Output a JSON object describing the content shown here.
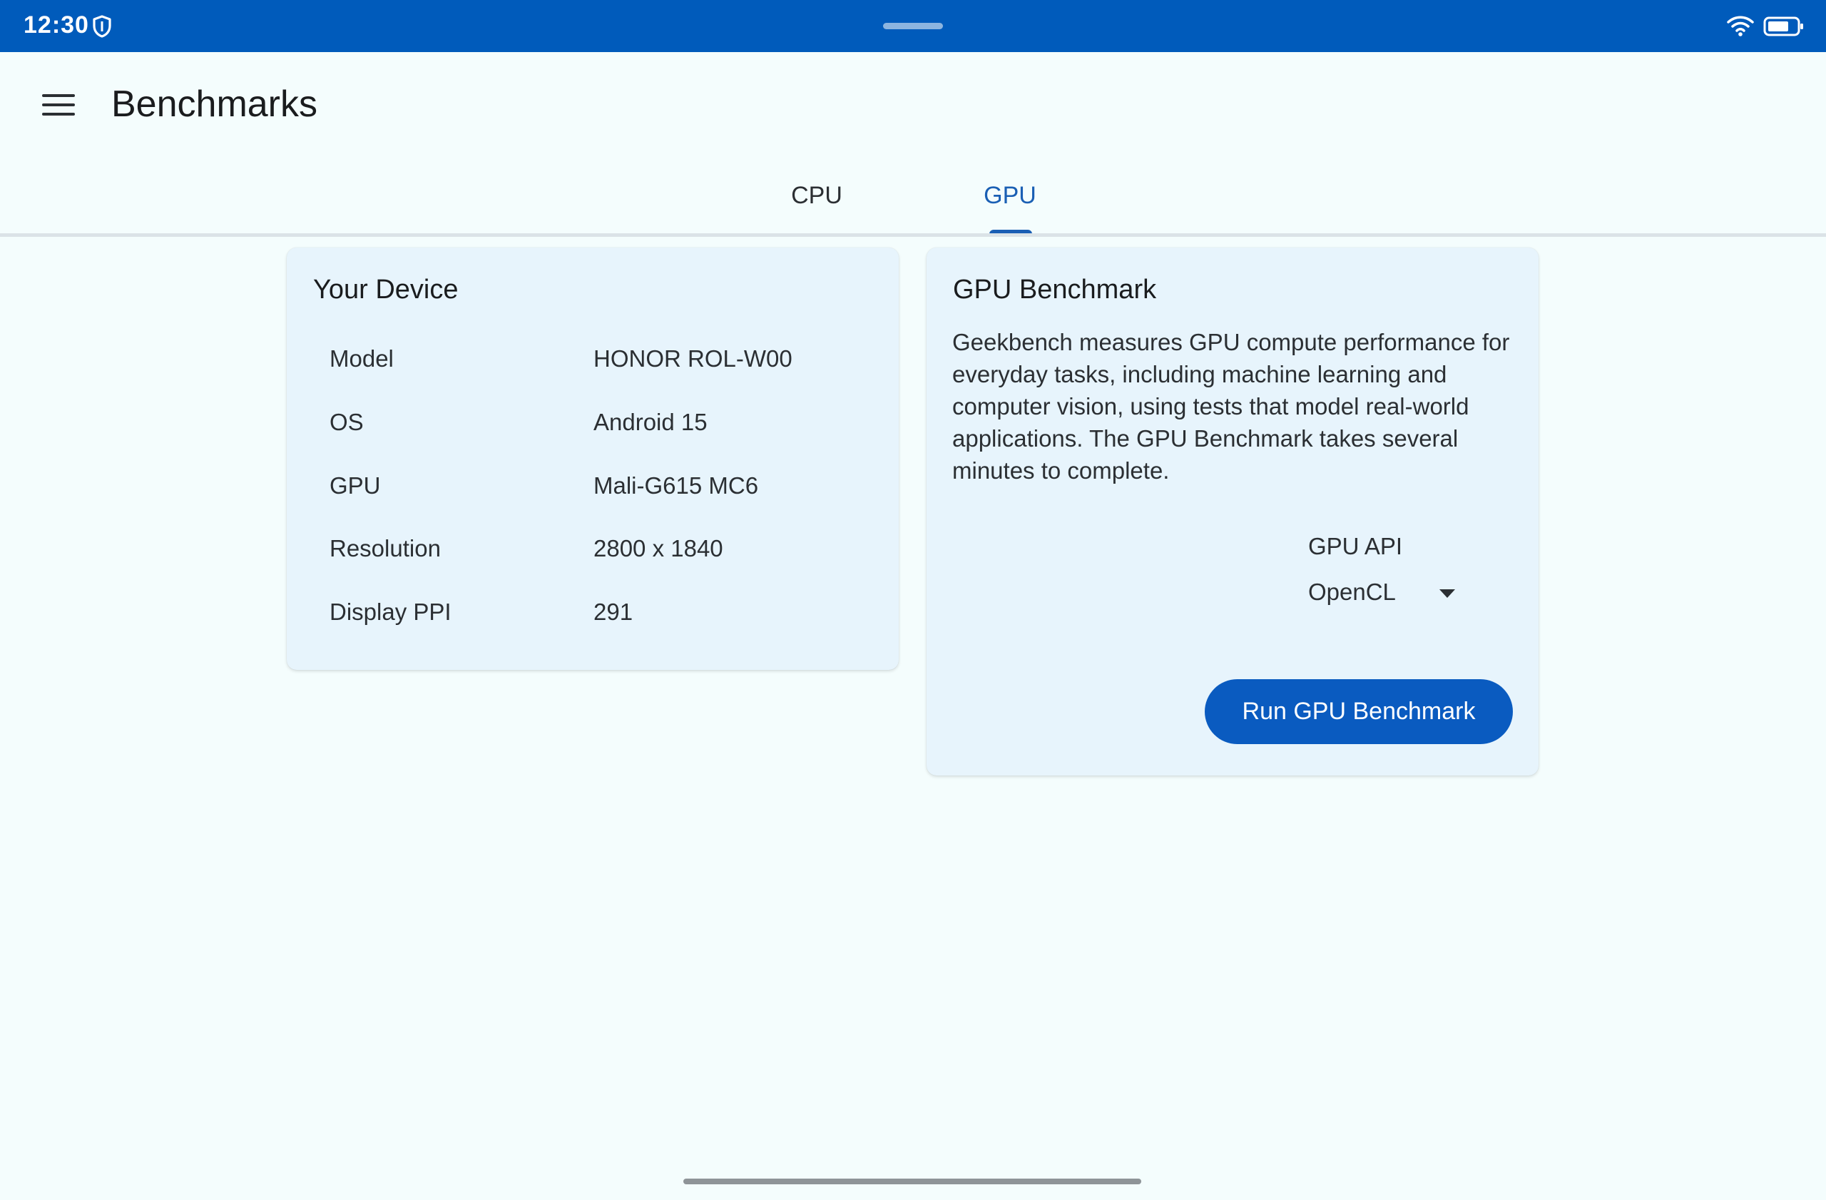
{
  "status_bar": {
    "time": "12:30",
    "icons": [
      "shield-icon",
      "wifi-icon",
      "battery-icon"
    ]
  },
  "app_bar": {
    "title": "Benchmarks",
    "menu_icon": "hamburger-menu-icon"
  },
  "tabs": [
    {
      "label": "CPU",
      "selected": false
    },
    {
      "label": "GPU",
      "selected": true
    }
  ],
  "device_card": {
    "title": "Your Device",
    "specs": [
      {
        "label": "Model",
        "value": "HONOR ROL-W00"
      },
      {
        "label": "OS",
        "value": "Android 15"
      },
      {
        "label": "GPU",
        "value": "Mali-G615 MC6"
      },
      {
        "label": "Resolution",
        "value": "2800 x 1840"
      },
      {
        "label": "Display PPI",
        "value": "291"
      }
    ]
  },
  "gpu_card": {
    "title": "GPU Benchmark",
    "description": "Geekbench measures GPU compute performance for everyday tasks, including machine learning and computer vision, using tests that model real-world applications. The GPU Benchmark takes several minutes to complete.",
    "api_label": "GPU API",
    "api_value": "OpenCL",
    "run_button": "Run GPU Benchmark"
  },
  "colors": {
    "status_bar": "#005bbb",
    "accent": "#1a5fb4",
    "button": "#0a5bc0",
    "background": "#f4fdfd",
    "card": "#e7f4fc"
  }
}
